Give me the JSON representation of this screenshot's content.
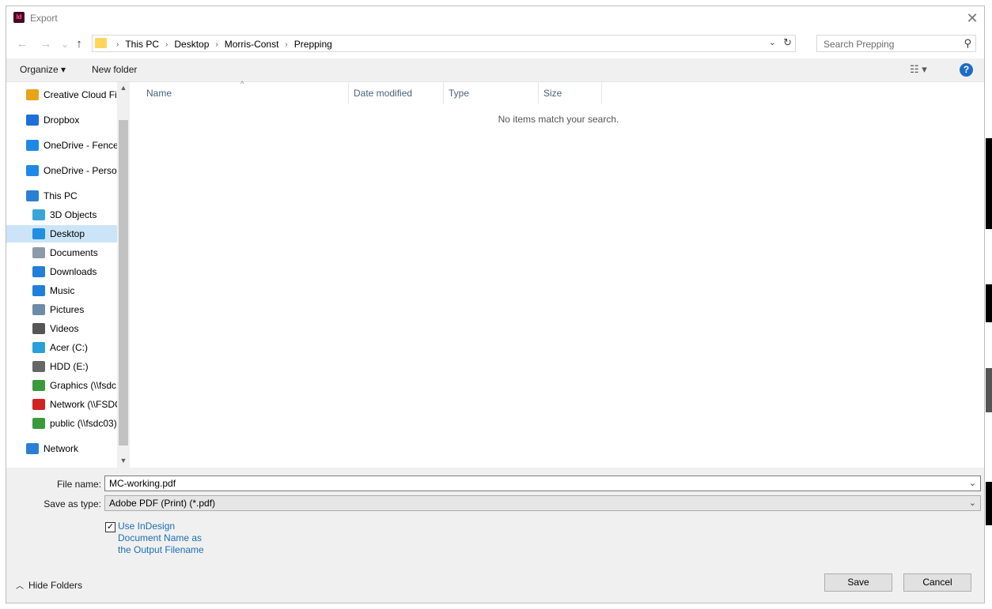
{
  "window": {
    "title": "Export",
    "app_icon_text": "Id",
    "close_glyph": "✕"
  },
  "nav": {
    "back": "←",
    "forward": "→",
    "recent": "⌄",
    "up": "↑"
  },
  "address": {
    "crumbs": [
      "This PC",
      "Desktop",
      "Morris-Const",
      "Prepping"
    ],
    "separator": "›"
  },
  "search": {
    "placeholder": "Search Prepping"
  },
  "toolbar": {
    "organize": "Organize ▾",
    "new_folder": "New folder",
    "help": "?",
    "view_glyph": "☷ ▾"
  },
  "sidebar": {
    "items": [
      {
        "label": "Creative Cloud Fil",
        "icon": "creative-cloud-icon",
        "color": "#e8a317"
      },
      {
        "label": "Dropbox",
        "icon": "dropbox-icon",
        "color": "#1e6fd9"
      },
      {
        "label": "OneDrive - FenceS",
        "icon": "onedrive-icon",
        "color": "#1e88e5"
      },
      {
        "label": "OneDrive - Persor",
        "icon": "onedrive-icon",
        "color": "#1e88e5"
      },
      {
        "label": "This PC",
        "icon": "computer-icon",
        "color": "#2a7fd4"
      },
      {
        "label": "3D Objects",
        "icon": "3d-objects-icon",
        "color": "#3aa6d8"
      },
      {
        "label": "Desktop",
        "icon": "desktop-icon",
        "color": "#1f8fe0"
      },
      {
        "label": "Documents",
        "icon": "documents-icon",
        "color": "#8d9aa8"
      },
      {
        "label": "Downloads",
        "icon": "downloads-icon",
        "color": "#1f7fd9"
      },
      {
        "label": "Music",
        "icon": "music-icon",
        "color": "#1f7fd9"
      },
      {
        "label": "Pictures",
        "icon": "pictures-icon",
        "color": "#6c8ba8"
      },
      {
        "label": "Videos",
        "icon": "videos-icon",
        "color": "#555555"
      },
      {
        "label": "Acer (C:)",
        "icon": "windows-drive-icon",
        "color": "#2aa0d8"
      },
      {
        "label": "HDD (E:)",
        "icon": "drive-icon",
        "color": "#666666"
      },
      {
        "label": "Graphics (\\\\fsdc",
        "icon": "network-drive-icon",
        "color": "#3a9a3a"
      },
      {
        "label": "Network (\\\\FSDC",
        "icon": "network-drive-disconnected-icon",
        "color": "#d02020"
      },
      {
        "label": "public (\\\\fsdc03)",
        "icon": "network-drive-icon",
        "color": "#3a9a3a"
      },
      {
        "label": "Network",
        "icon": "network-icon",
        "color": "#2a7fd4"
      }
    ],
    "selected": "Desktop"
  },
  "filelist": {
    "columns": [
      "Name",
      "Date modified",
      "Type",
      "Size"
    ],
    "empty_message": "No items match your search."
  },
  "form": {
    "filename_label": "File name:",
    "filename_value": "MC-working.pdf",
    "savetype_label": "Save as type:",
    "savetype_value": "Adobe PDF (Print) (*.pdf)",
    "checkbox_checked": true,
    "checkbox_label": "Use InDesign Document Name as the Output Filename"
  },
  "footer": {
    "hide_folders": "Hide Folders",
    "save": "Save",
    "cancel": "Cancel"
  }
}
